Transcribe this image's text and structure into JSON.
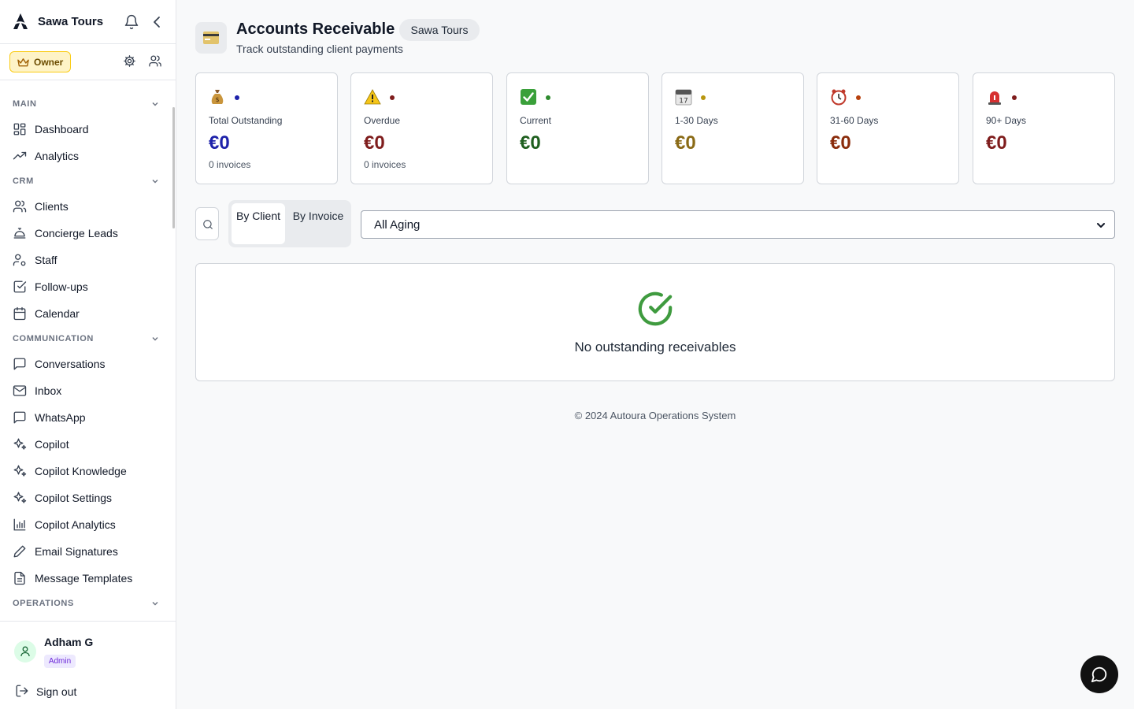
{
  "sidebar": {
    "brand": "Sawa Tours",
    "role_badge": "Owner",
    "sections": {
      "main": "MAIN",
      "crm": "CRM",
      "communication": "COMMUNICATION",
      "operations": "OPERATIONS"
    },
    "items": [
      {
        "label": "Dashboard",
        "icon": "grid-icon"
      },
      {
        "label": "Analytics",
        "icon": "trending-up-icon"
      },
      {
        "label": "Clients",
        "icon": "users-icon"
      },
      {
        "label": "Concierge Leads",
        "icon": "concierge-bell-icon"
      },
      {
        "label": "Staff",
        "icon": "user-cog-icon"
      },
      {
        "label": "Follow-ups",
        "icon": "check-square-icon"
      },
      {
        "label": "Calendar",
        "icon": "calendar-icon"
      },
      {
        "label": "Conversations",
        "icon": "message-square-icon"
      },
      {
        "label": "Inbox",
        "icon": "mail-icon"
      },
      {
        "label": "WhatsApp",
        "icon": "message-square-icon"
      },
      {
        "label": "Copilot",
        "icon": "sparkles-icon"
      },
      {
        "label": "Copilot Knowledge",
        "icon": "sparkles-icon"
      },
      {
        "label": "Copilot Settings",
        "icon": "sparkles-icon"
      },
      {
        "label": "Copilot Analytics",
        "icon": "bar-chart-icon"
      },
      {
        "label": "Email Signatures",
        "icon": "pen-icon"
      },
      {
        "label": "Message Templates",
        "icon": "file-text-icon"
      }
    ],
    "user": {
      "name": "Adham G",
      "role": "Admin"
    },
    "sign_out": "Sign out"
  },
  "header": {
    "title": "Accounts Receivable",
    "org_pill": "Sawa Tours",
    "subtitle": "Track outstanding client payments"
  },
  "stats": [
    {
      "emoji": "money-bag-icon",
      "label": "Total Outstanding",
      "value": "€0",
      "sub": "0 invoices",
      "color": "#1e22aa"
    },
    {
      "emoji": "warning-icon",
      "label": "Overdue",
      "value": "€0",
      "sub": "0 invoices",
      "color": "#7f1d1d"
    },
    {
      "emoji": "check-box-icon",
      "label": "Current",
      "value": "€0",
      "sub": "",
      "color": "#1f5f1f"
    },
    {
      "emoji": "calendar-icon",
      "label": "1-30 Days",
      "value": "€0",
      "sub": "",
      "color": "#8a6a16"
    },
    {
      "emoji": "alarm-clock-icon",
      "label": "31-60 Days",
      "value": "€0",
      "sub": "",
      "color": "#8a2c0c"
    },
    {
      "emoji": "siren-icon",
      "label": "90+ Days",
      "value": "€0",
      "sub": "",
      "color": "#7f1d1d"
    }
  ],
  "calendar_emoji_text": "17",
  "toolbar": {
    "view_by_client": "By Client",
    "view_by_invoice": "By Invoice",
    "aging_filter": "All Aging"
  },
  "empty_state": "No outstanding receivables",
  "footer": "© 2024 Autoura Operations System"
}
